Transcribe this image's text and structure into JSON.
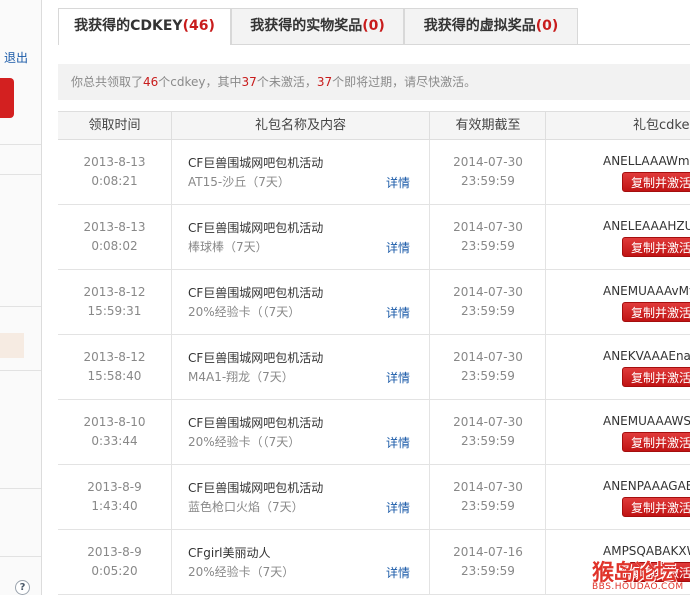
{
  "sidebar": {
    "logout_label": "退出",
    "help_icon": "question-icon",
    "help_glyph": "?"
  },
  "tabs": [
    {
      "label": "我获得的CDKEY",
      "count": "(46)"
    },
    {
      "label": "我获得的实物奖品",
      "count": "(0)"
    },
    {
      "label": "我获得的虚拟奖品",
      "count": "(0)"
    }
  ],
  "notice": {
    "p1": "你总共领取了",
    "n1": "46",
    "p2": "个cdkey，其中",
    "n2": "37",
    "p3": "个未激活，",
    "n3": "37",
    "p4": "个即将过期，请尽快激活。"
  },
  "table": {
    "headers": [
      "领取时间",
      "礼包名称及内容",
      "有效期截至",
      "礼包cdkey"
    ],
    "detail_label": "详情",
    "copy_label": "复制并激活",
    "rows": [
      {
        "date": "2013-8-13",
        "time": "0:08:21",
        "name": "CF巨兽围城网吧包机活动",
        "item": "AT15-沙丘（7天）",
        "exp_date": "2014-07-30",
        "exp_time": "23:59:59",
        "cdkey": "ANELLAAAWmkk"
      },
      {
        "date": "2013-8-13",
        "time": "0:08:02",
        "name": "CF巨兽围城网吧包机活动",
        "item": "棒球棒（7天）",
        "exp_date": "2014-07-30",
        "exp_time": "23:59:59",
        "cdkey": "ANELEAAAHZU"
      },
      {
        "date": "2013-8-12",
        "time": "15:59:31",
        "name": "CF巨兽围城网吧包机活动",
        "item": "20%经验卡（（7天）",
        "exp_date": "2014-07-30",
        "exp_time": "23:59:59",
        "cdkey": "ANEMUAAAvMys"
      },
      {
        "date": "2013-8-12",
        "time": "15:58:40",
        "name": "CF巨兽围城网吧包机活动",
        "item": "M4A1-翔龙（7天）",
        "exp_date": "2014-07-30",
        "exp_time": "23:59:59",
        "cdkey": "ANEKVAAAEnaA"
      },
      {
        "date": "2013-8-10",
        "time": "0:33:44",
        "name": "CF巨兽围城网吧包机活动",
        "item": "20%经验卡（（7天）",
        "exp_date": "2014-07-30",
        "exp_time": "23:59:59",
        "cdkey": "ANEMUAAAWSx"
      },
      {
        "date": "2013-8-9",
        "time": "1:43:40",
        "name": "CF巨兽围城网吧包机活动",
        "item": "蓝色枪口火焰（7天）",
        "exp_date": "2014-07-30",
        "exp_time": "23:59:59",
        "cdkey": "ANENPAAAGAEW"
      },
      {
        "date": "2013-8-9",
        "time": "0:05:20",
        "name": "CFgirl美丽动人",
        "item": "20%经验卡（7天）",
        "exp_date": "2014-07-16",
        "exp_time": "23:59:59",
        "cdkey": "AMPSQABAKXWA"
      }
    ]
  },
  "watermark": {
    "main": "猴岛论坛",
    "sub": "BBS.HOUDAO.COM"
  },
  "colors": {
    "accent_red": "#c81c1c",
    "button_red": "#d32020",
    "link_blue": "#1a5aa8"
  }
}
